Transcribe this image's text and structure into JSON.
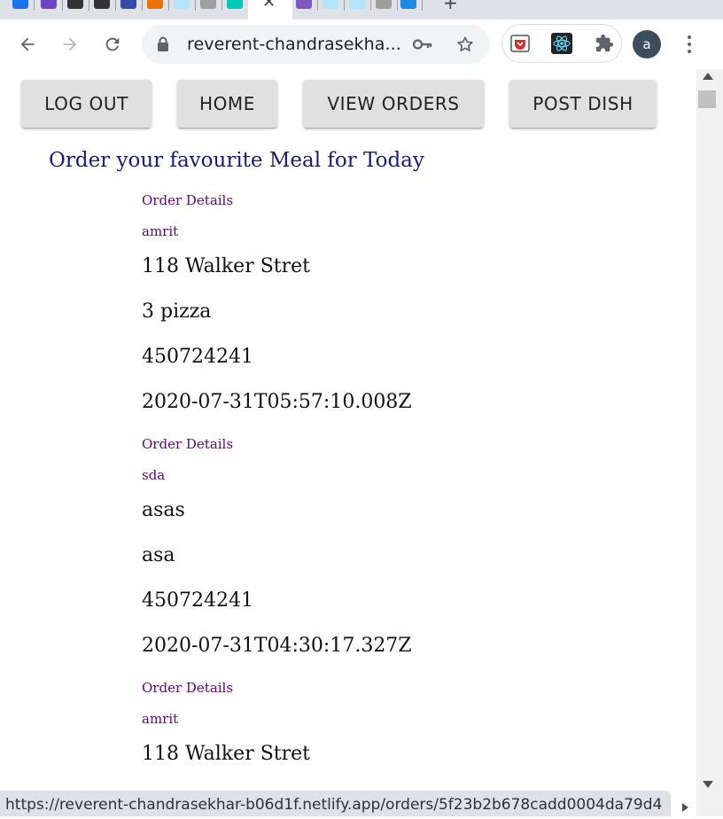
{
  "browser": {
    "url_display": "reverent-chandrasekha...",
    "profile_initial": "a",
    "status_url": "https://reverent-chandrasekhar-b06d1f.netlify.app/orders/5f23b2b678cadd0004da79d4",
    "tab_favicon_colors": [
      "#1a73e8",
      "#6f42c1",
      "#333333",
      "#333333",
      "#3949ab",
      "#e8710a",
      "#b3e5fc",
      "#9e9e9e",
      "#00c7b7",
      "#7e57c2",
      "#b3e5fc",
      "#b3e5fc",
      "#9e9e9e",
      "#1e88e5"
    ]
  },
  "navbar": {
    "logout": "LOG OUT",
    "home": "HOME",
    "view_orders": "VIEW ORDERS",
    "post_dish": "POST DISH"
  },
  "page": {
    "heading": "Order your favourite Meal for Today"
  },
  "orders": [
    {
      "title": "Order Details",
      "name": "amrit",
      "address": "118 Walker Stret",
      "dish": "3 pizza",
      "phone": "450724241",
      "timestamp": "2020-07-31T05:57:10.008Z"
    },
    {
      "title": "Order Details",
      "name": "sda",
      "address": "asas",
      "dish": "asa",
      "phone": "450724241",
      "timestamp": "2020-07-31T04:30:17.327Z"
    },
    {
      "title": "Order Details",
      "name": "amrit",
      "address": "118 Walker Stret"
    }
  ],
  "colors": {
    "heading": "#1a1a6e",
    "order_meta": "#5a0a6e",
    "button_bg": "#e0e0e0"
  }
}
